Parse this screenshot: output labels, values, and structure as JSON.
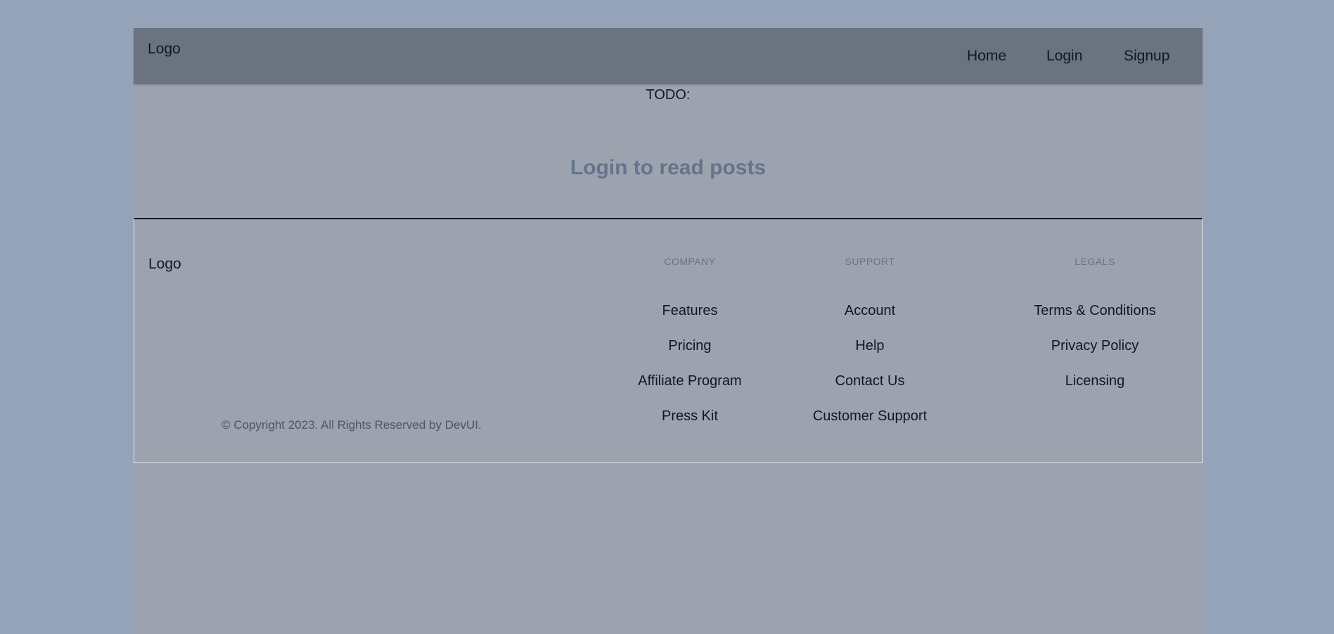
{
  "navbar": {
    "logo": "Logo",
    "links": [
      "Home",
      "Login",
      "Signup"
    ]
  },
  "main": {
    "todo": "TODO:",
    "login_message": "Login to read posts"
  },
  "footer": {
    "logo": "Logo",
    "copyright": "© Copyright 2023. All Rights Reserved by DevUI.",
    "columns": [
      {
        "heading": "COMPANY",
        "links": [
          "Features",
          "Pricing",
          "Affiliate Program",
          "Press Kit"
        ]
      },
      {
        "heading": "SUPPORT",
        "links": [
          "Account",
          "Help",
          "Contact Us",
          "Customer Support"
        ]
      },
      {
        "heading": "LEGALS",
        "links": [
          "Terms & Conditions",
          "Privacy Policy",
          "Licensing"
        ]
      }
    ]
  },
  "colors": {
    "page_background": "#94a3b8",
    "app_background": "#9ca3af",
    "navbar_background": "#6b7280",
    "muted_heading": "#64748b"
  }
}
